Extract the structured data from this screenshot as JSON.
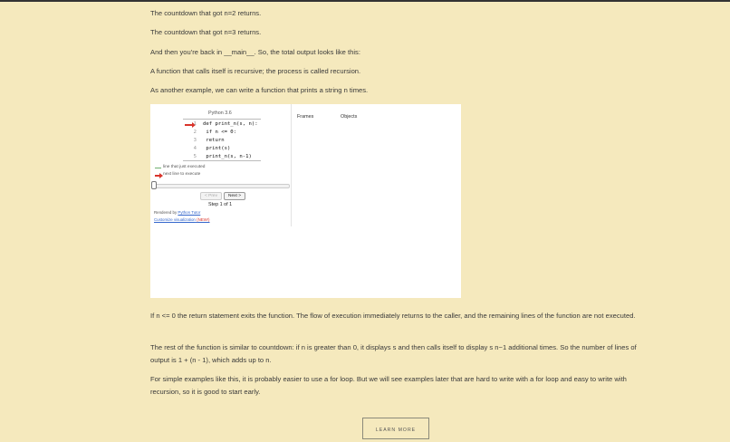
{
  "paragraphs_top": [
    "The countdown that got n=2 returns.",
    "The countdown that got n=3 returns.",
    "And then you're back in __main__. So, the total output looks like this:",
    "A function that calls itself is recursive; the process is called recursion.",
    "As another example, we can write a function that prints a string n times."
  ],
  "visualizer": {
    "language": "Python 3.6",
    "code": [
      {
        "num": "1",
        "text": "def print_n(s, n):"
      },
      {
        "num": "2",
        "text": "    if n <= 0:"
      },
      {
        "num": "3",
        "text": "        return"
      },
      {
        "num": "4",
        "text": "    print(s)"
      },
      {
        "num": "5",
        "text": "    print_n(s, n-1)"
      }
    ],
    "legend_executed": "line that just executed",
    "legend_next": "next line to execute",
    "prev_label": "< Prev",
    "next_label": "Next >",
    "step_text": "Step 1 of 1",
    "rendered_by": "Rendered by",
    "rendered_link": "Python Tutor",
    "customize_link": "Customize visualization",
    "new_badge": "(NEW!)",
    "frames_label": "Frames",
    "objects_label": "Objects",
    "colors": {
      "next_arrow": "#d9342b",
      "executed_arrow": "#6fb06f"
    }
  },
  "paragraphs_bottom": [
    "If n <= 0 the return statement exits the function. The flow of execution immediately returns to the caller, and the remaining lines of the function are not executed.",
    "The rest of the function is similar to countdown: if n is greater than 0, it displays s and then calls itself to display s n−1 additional times. So the number of lines of output is 1 + (n - 1), which adds up to n.",
    "For simple examples like this, it is probably easier to use a for loop. But we will see examples later that are hard to write with a for loop and easy to write with recursion, so it is good to start early."
  ],
  "learn_more": "LEARN MORE",
  "theme": {
    "background": "#f5e9bd",
    "text": "#3a3a3a"
  }
}
